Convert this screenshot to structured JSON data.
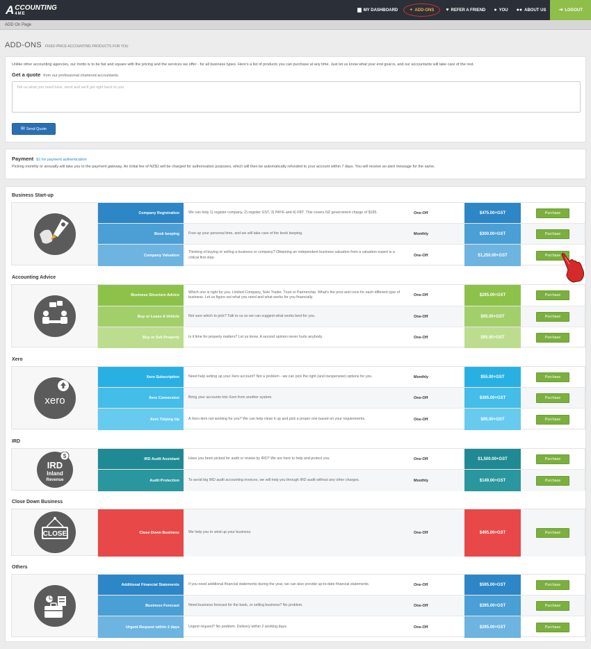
{
  "nav": {
    "logo_big": "A",
    "logo_line1": "CCOUNTING",
    "logo_line2": "4ME",
    "items": [
      {
        "label": "MY DASHBOARD",
        "icon": "chart-icon"
      },
      {
        "label": "ADD-ONS",
        "icon": "plus-icon"
      },
      {
        "label": "REFER A FRIEND",
        "icon": "heart-icon"
      },
      {
        "label": "YOU",
        "icon": "user-icon"
      },
      {
        "label": "ABOUT US",
        "icon": "group-icon"
      },
      {
        "label": "LOGOUT",
        "icon": "logout-icon"
      }
    ]
  },
  "breadcrumb": "ADD On Page",
  "page": {
    "title": "ADD-ONS",
    "subtitle": "FIXED PRICE ACCOUNTING PRODUCTS FOR YOU"
  },
  "quote": {
    "intro": "Unlike other accounting agencies, our motto is to be fair and square with the pricing and the services we offer - for all business types. Here's a list of products you can purchase at any time. Just let us know what your end goal is, and our accountants will take care of the rest.",
    "title": "Get a quote",
    "subtitle": "from our professional chartered accountants.",
    "placeholder": "Tell us what you need here, send and we'll get right back to you.",
    "button": "Send Quote"
  },
  "payment": {
    "title": "Payment",
    "subtitle": "$1 for payment authentication",
    "text": "Picking monthly or annually will take you to the payment gateway. An initial fee of NZ$1 will be charged for authorization purposes, which will then be automatically refunded to your account within 7 days. You will receive an alert message for the same."
  },
  "categories": [
    {
      "title": "Business Start-up",
      "icon": "rocket-icon",
      "rows": [
        {
          "name": "Company Registration",
          "desc": "We can help 1) register company, 2) register GST, 3) PAYE and 4) FBT. This covers NZ government charge of $165.",
          "freq": "One-Off",
          "price": "$475.00+GST",
          "button": "Purchase"
        },
        {
          "name": "Book keeping",
          "desc": "Free up your personal time, and we will take care of the book keeping.",
          "freq": "Monthly",
          "price": "$300.00+GST",
          "button": "Purchase"
        },
        {
          "name": "Company Valuation",
          "desc": "Thinking of buying or selling a business or company? Obtaining an independent business valuation from a valuation expert is a critical first step.",
          "freq": "One-Off",
          "price": "$1,250.00+GST",
          "button": "Purchase"
        }
      ]
    },
    {
      "title": "Accounting Advice",
      "icon": "meeting-icon",
      "rows": [
        {
          "name": "Business Structure Advice",
          "desc": "Which one is right for you, Limited Company, Sole Trader, Trust or Partnership. What's the pros and cons for each different type of business. Let us figure out what you need and what works for you financially.",
          "freq": "One-Off",
          "price": "$295.00+GST",
          "button": "Purchase"
        },
        {
          "name": "Buy or Lease A Vehicle",
          "desc": "Not sure which to pick? Talk to us so we can suggest what works best for you.",
          "freq": "One-Off",
          "price": "$95.00+GST",
          "button": "Purchase"
        },
        {
          "name": "Buy or Sell Property",
          "desc": "Is it time for property matters? Let us know. A second opinion never hurts anybody.",
          "freq": "One-Off",
          "price": "$95.00+GST",
          "button": "Purchase"
        }
      ]
    },
    {
      "title": "Xero",
      "icon": "xero-icon",
      "icon_text": "xero",
      "rows": [
        {
          "name": "Xero Subscription",
          "desc": "Need help setting up your Xero account? Not a problem - we can pick the right (and inexpensive) options for you.",
          "freq": "Monthly",
          "price": "$55.00+GST",
          "button": "Purchase"
        },
        {
          "name": "Xero Conversion",
          "desc": "Bring your accounts into Xero from another system.",
          "freq": "One-Off",
          "price": "$395.00+GST",
          "button": "Purchase"
        },
        {
          "name": "Xero Tidying Up",
          "desc": "A Xero item not working for you? We can help clean it up and pick a proper one based on your requirements.",
          "freq": "One-Off",
          "price": "$95.00+GST",
          "button": "Purchase"
        }
      ]
    },
    {
      "title": "IRD",
      "icon": "ird-icon",
      "icon_text": [
        "IRD",
        "Inland",
        "Revenue"
      ],
      "rows": [
        {
          "name": "IRD Audit Assistant",
          "desc": "Have you been picked for audit or review by IRD? We are here to help and protect you.",
          "freq": "One-Off",
          "price": "$1,500.00+GST",
          "button": "Purchase"
        },
        {
          "name": "Audit Protection",
          "desc": "To avoid big IRD audit accounting invoices, we will help you through IRD audit without any other charges.",
          "freq": "Monthly",
          "price": "$149.00+GST",
          "button": "Purchase"
        }
      ]
    },
    {
      "title": "Close Down Business",
      "icon": "closed-sign-icon",
      "icon_text": "CLOSE",
      "rows": [
        {
          "name": "Close Down Business",
          "desc": "We help you to wind up your business.",
          "freq": "One-Off",
          "price": "$495.00+GST",
          "button": "Purchase"
        }
      ]
    },
    {
      "title": "Others",
      "icon": "briefcase-icon",
      "rows": [
        {
          "name": "Additional Financial Statements",
          "desc": "If you need additional financial statements during the year, we can also provide up-to-date financial statements.",
          "freq": "One-Off",
          "price": "$595.00+GST",
          "button": "Purchase"
        },
        {
          "name": "Business Forecast",
          "desc": "Need business forecast for the bank, or selling business? No problem.",
          "freq": "One-Off",
          "price": "$395.00+GST",
          "button": "Purchase"
        },
        {
          "name": "Urgent Request within 2 days",
          "desc": "Urgent request? No problem. Delivery within 2 working days.",
          "freq": "One-Off",
          "price": "$295.00+GST",
          "button": "Purchase"
        }
      ]
    }
  ],
  "colors": {
    "nav_bg": "#2b3038",
    "active_text": "#f6a74a",
    "active_ring": "#d8302e",
    "logout_bg": "#8fbe4a",
    "blue_1": "#2d86c6",
    "blue_2": "#4a9fd5",
    "blue_3": "#6db4e0",
    "green_1": "#8dc24a",
    "green_2": "#a3cf6b",
    "green_3": "#bcdd8e",
    "cyan_1": "#29b0e2",
    "cyan_2": "#44bde8",
    "cyan_3": "#66cbee",
    "teal_1": "#1f8a93",
    "teal_2": "#2a969e",
    "red": "#e84848",
    "purchase_btn": "#7bb03e"
  }
}
